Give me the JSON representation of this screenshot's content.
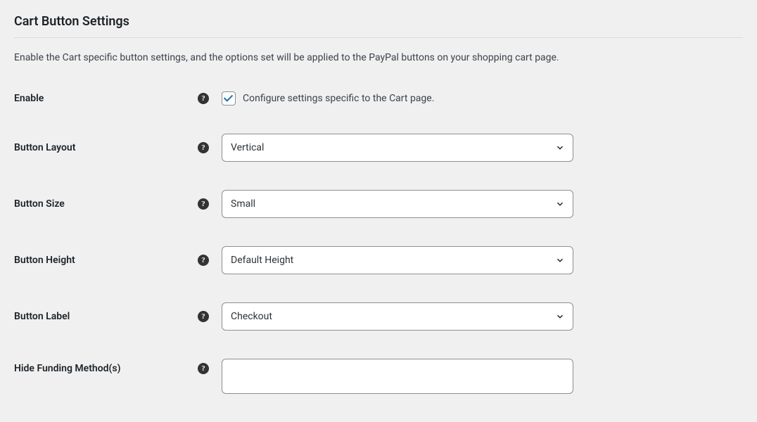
{
  "section": {
    "title": "Cart Button Settings",
    "description": "Enable the Cart specific button settings, and the options set will be applied to the PayPal buttons on your shopping cart page."
  },
  "fields": {
    "enable": {
      "label": "Enable",
      "checkbox_label": "Configure settings specific to the Cart page.",
      "checked": true
    },
    "button_layout": {
      "label": "Button Layout",
      "value": "Vertical"
    },
    "button_size": {
      "label": "Button Size",
      "value": "Small"
    },
    "button_height": {
      "label": "Button Height",
      "value": "Default Height"
    },
    "button_label": {
      "label": "Button Label",
      "value": "Checkout"
    },
    "hide_funding": {
      "label": "Hide Funding Method(s)",
      "value": ""
    }
  }
}
